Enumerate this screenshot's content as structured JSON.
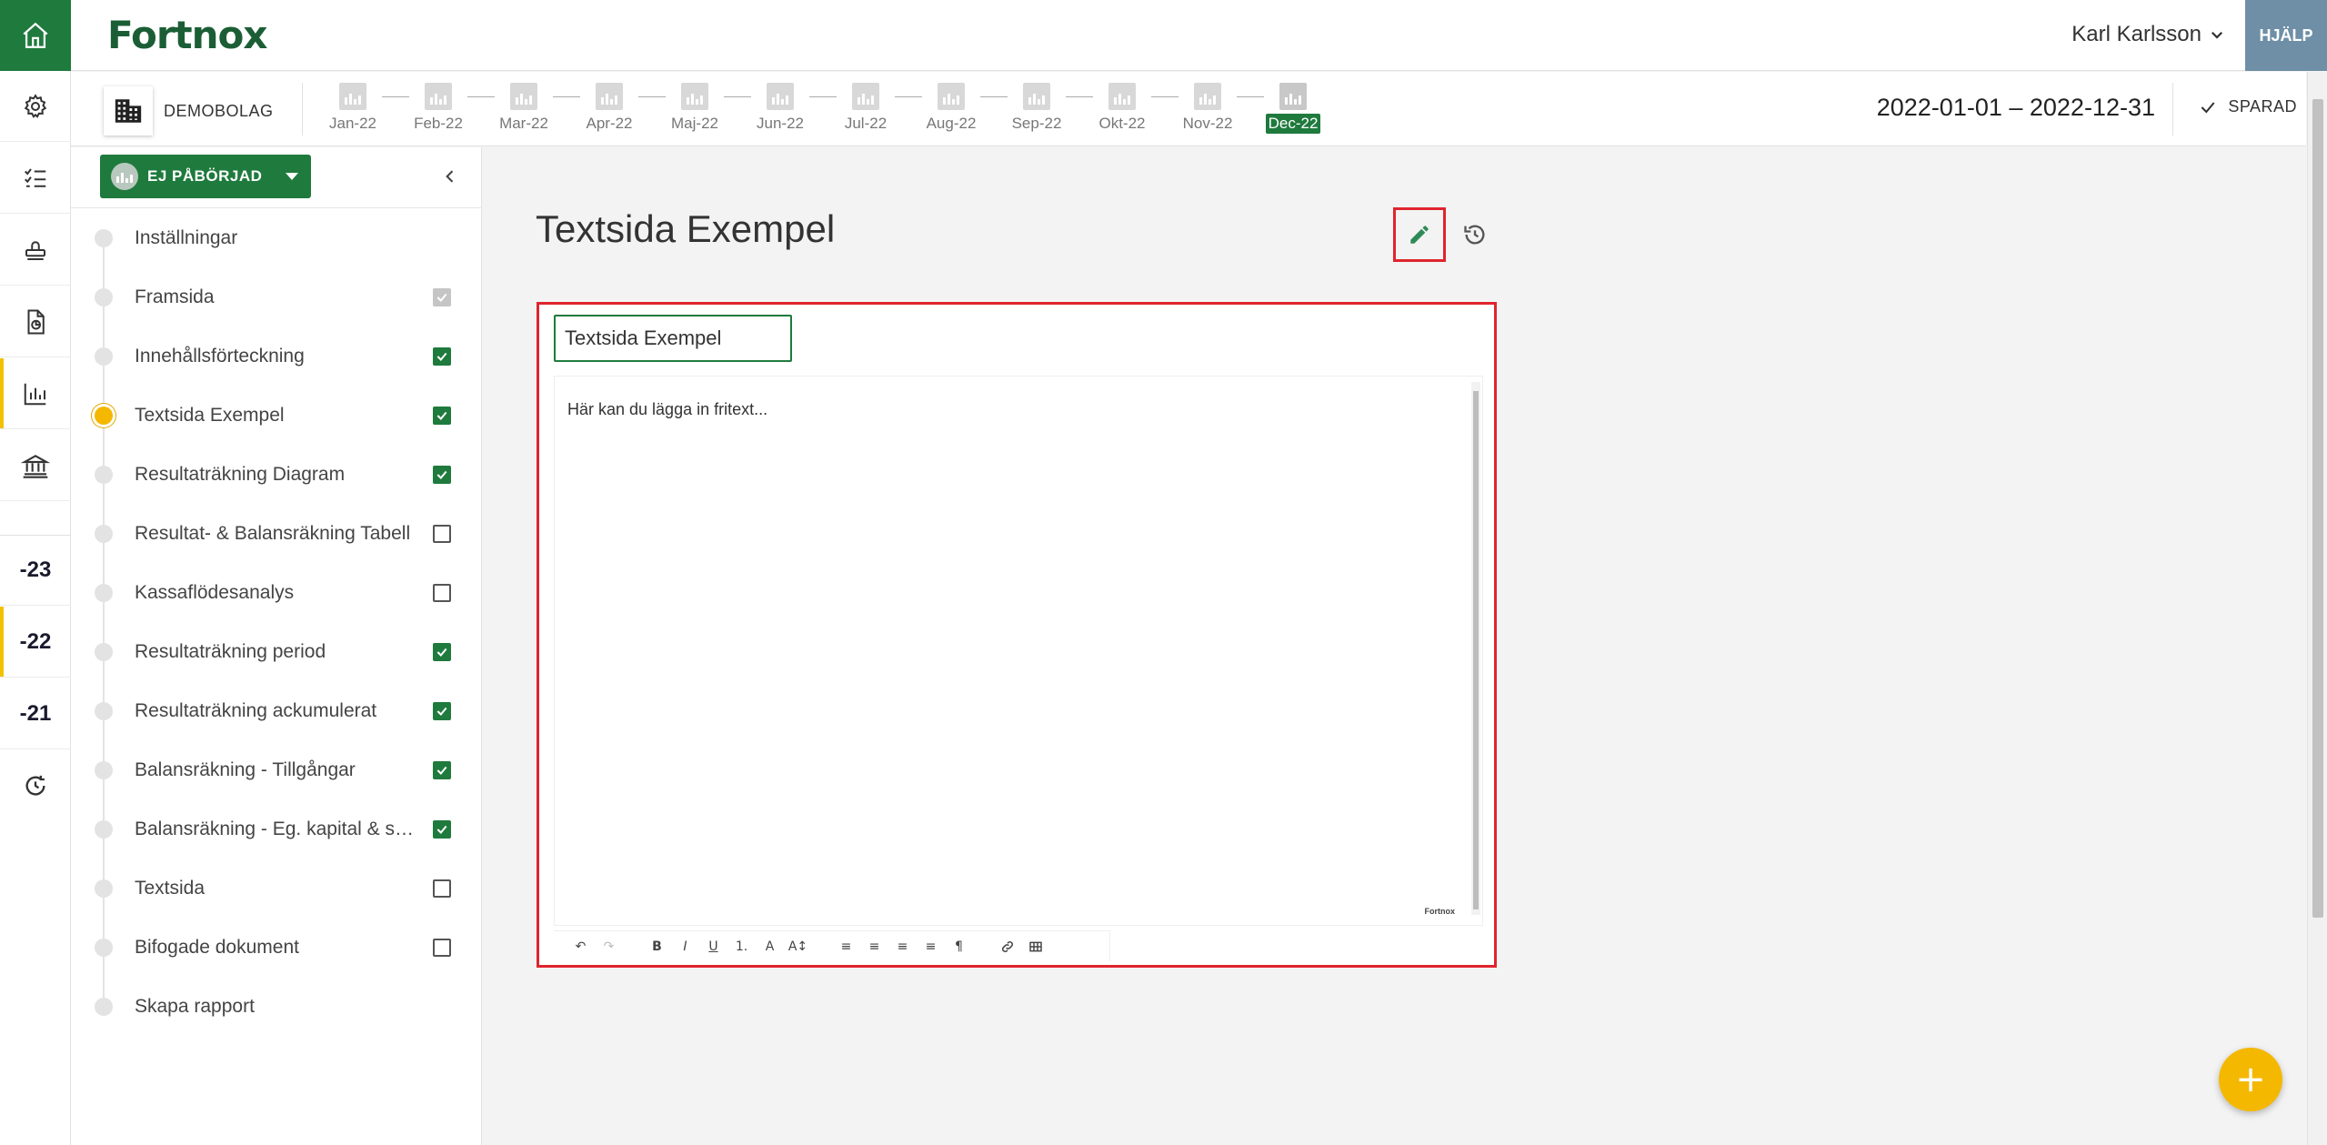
{
  "header": {
    "logo": "Fortnox",
    "user_name": "Karl Karlsson",
    "help_label": "HJÄLP"
  },
  "subheader": {
    "company": "DEMOBOLAG",
    "months": [
      "Jan-22",
      "Feb-22",
      "Mar-22",
      "Apr-22",
      "Maj-22",
      "Jun-22",
      "Jul-22",
      "Aug-22",
      "Sep-22",
      "Okt-22",
      "Nov-22",
      "Dec-22"
    ],
    "active_month": "Dec-22",
    "period": "2022-01-01 – 2022-12-31",
    "saved_label": "SPARAD"
  },
  "rail": {
    "years": [
      "-23",
      "-22",
      "-21"
    ],
    "active_year": "-22"
  },
  "sidebar": {
    "status_label": "EJ PÅBÖRJAD",
    "steps": [
      {
        "label": "Inställningar",
        "check": "none",
        "current": false
      },
      {
        "label": "Framsida",
        "check": "grey",
        "current": false
      },
      {
        "label": "Innehållsförteckning",
        "check": "on",
        "current": false
      },
      {
        "label": "Textsida Exempel",
        "check": "on",
        "current": true
      },
      {
        "label": "Resultaträkning Diagram",
        "check": "on",
        "current": false
      },
      {
        "label": "Resultat- & Balansräkning Tabell",
        "check": "off",
        "current": false
      },
      {
        "label": "Kassaflödesanalys",
        "check": "off",
        "current": false
      },
      {
        "label": "Resultaträkning period",
        "check": "on",
        "current": false
      },
      {
        "label": "Resultaträkning ackumulerat",
        "check": "on",
        "current": false
      },
      {
        "label": "Balansräkning - Tillgångar",
        "check": "on",
        "current": false
      },
      {
        "label": "Balansräkning - Eg. kapital & skulder",
        "check": "on",
        "current": false
      },
      {
        "label": "Textsida",
        "check": "off",
        "current": false
      },
      {
        "label": "Bifogade dokument",
        "check": "off",
        "current": false
      },
      {
        "label": "Skapa rapport",
        "check": "none",
        "current": false
      }
    ]
  },
  "main": {
    "page_title": "Textsida Exempel",
    "title_input_value": "Textsida Exempel",
    "editor_placeholder": "Här kan du lägga in fritext...",
    "editor_brand": "Fortnox",
    "toolbar": {
      "undo": "↶",
      "redo": "↷",
      "bold": "B",
      "italic": "I",
      "underline": "U",
      "list": "1.",
      "color": "A",
      "size": "A↕",
      "align_left": "≡",
      "align_center": "≡",
      "align_right": "≡",
      "justify": "≡",
      "paragraph": "¶",
      "link": "🔗",
      "table": "▦"
    },
    "fab_label": "+"
  },
  "colors": {
    "brand_green": "#1f7a3d",
    "accent_yellow": "#f5b800",
    "highlight_red": "#e0242e",
    "help_blue": "#6e8fa6"
  }
}
